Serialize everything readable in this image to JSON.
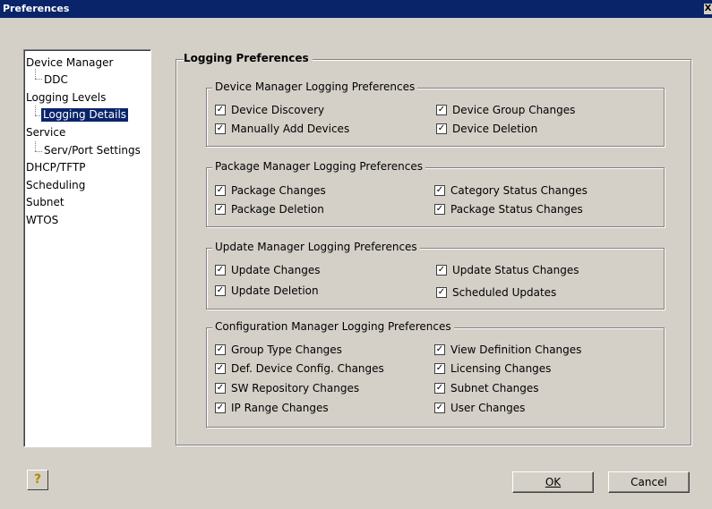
{
  "window": {
    "title": "Preferences",
    "close_glyph": "X"
  },
  "tree": {
    "items": [
      {
        "label": "Device Manager"
      },
      {
        "label": "DDC"
      },
      {
        "label": "Logging Levels"
      },
      {
        "label": "Logging Details"
      },
      {
        "label": "Service"
      },
      {
        "label": "Serv/Port Settings"
      },
      {
        "label": "DHCP/TFTP"
      },
      {
        "label": "Scheduling"
      },
      {
        "label": "Subnet"
      },
      {
        "label": "WTOS"
      }
    ]
  },
  "main": {
    "title": "Logging Preferences",
    "groups": [
      {
        "title": "Device Manager Logging Preferences",
        "items": [
          {
            "label": "Device Discovery",
            "checked": true
          },
          {
            "label": "Device Group Changes",
            "checked": true
          },
          {
            "label": "Manually Add Devices",
            "checked": true
          },
          {
            "label": "Device Deletion",
            "checked": true
          }
        ]
      },
      {
        "title": "Package Manager Logging Preferences",
        "items": [
          {
            "label": "Package Changes",
            "checked": true
          },
          {
            "label": "Category Status Changes",
            "checked": true
          },
          {
            "label": "Package Deletion",
            "checked": true
          },
          {
            "label": "Package Status Changes",
            "checked": true
          }
        ]
      },
      {
        "title": "Update Manager Logging Preferences",
        "items": [
          {
            "label": "Update Changes",
            "checked": true
          },
          {
            "label": "Update Status Changes",
            "checked": true
          },
          {
            "label": "Update Deletion",
            "checked": true
          },
          {
            "label": "Scheduled Updates",
            "checked": true
          }
        ]
      },
      {
        "title": "Configuration Manager Logging Preferences",
        "items": [
          {
            "label": "Group Type Changes",
            "checked": true
          },
          {
            "label": "View Definition Changes",
            "checked": true
          },
          {
            "label": "Def. Device Config. Changes",
            "checked": true
          },
          {
            "label": "Licensing Changes",
            "checked": true
          },
          {
            "label": "SW Repository Changes",
            "checked": true
          },
          {
            "label": "Subnet Changes",
            "checked": true
          },
          {
            "label": "IP Range Changes",
            "checked": true
          },
          {
            "label": "User Changes",
            "checked": true
          }
        ]
      }
    ]
  },
  "buttons": {
    "ok": "OK",
    "cancel": "Cancel",
    "help_glyph": "?"
  },
  "check_glyph": "✓",
  "colors": {
    "titlebar": "#0a246a",
    "face": "#d4d0c8",
    "selection": "#0a246a"
  }
}
